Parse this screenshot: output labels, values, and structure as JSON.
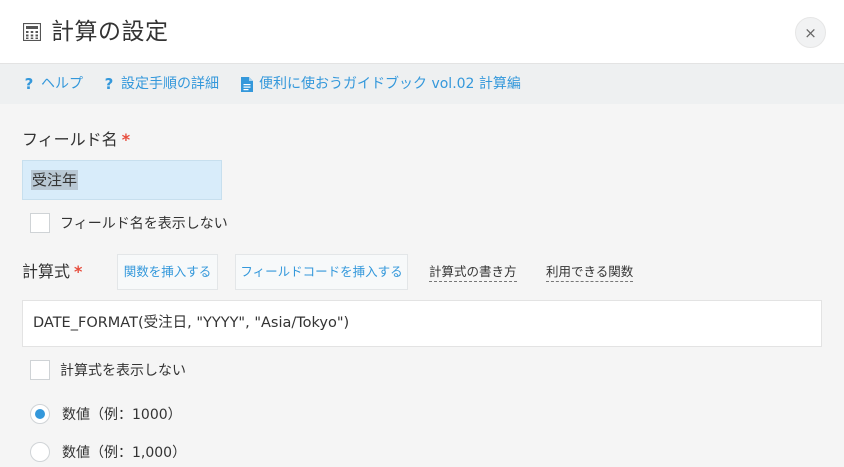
{
  "header": {
    "title": "計算の設定",
    "close_label": "×"
  },
  "help_links": [
    {
      "label": "ヘルプ",
      "icon": "question-icon"
    },
    {
      "label": "設定手順の詳細",
      "icon": "question-icon"
    },
    {
      "label": "便利に使おうガイドブック vol.02 計算編",
      "icon": "document-icon"
    }
  ],
  "field_name": {
    "label": "フィールド名",
    "required_mark": "*",
    "value": "受注年",
    "hide_label": "フィールド名を表示しない"
  },
  "formula": {
    "label": "計算式",
    "required_mark": "*",
    "insert_function_label": "関数を挿入する",
    "insert_field_code_label": "フィールドコードを挿入する",
    "how_to_write_label": "計算式の書き方",
    "available_functions_label": "利用できる関数",
    "value": "DATE_FORMAT(受注日, \"YYYY\", \"Asia/Tokyo\")",
    "hide_label": "計算式を表示しない"
  },
  "format_options": [
    {
      "label": "数値（例：1000）",
      "selected": true
    },
    {
      "label": "数値（例：1,000）",
      "selected": false
    }
  ],
  "colors": {
    "accent": "#3498db",
    "required": "#e74c3c"
  }
}
